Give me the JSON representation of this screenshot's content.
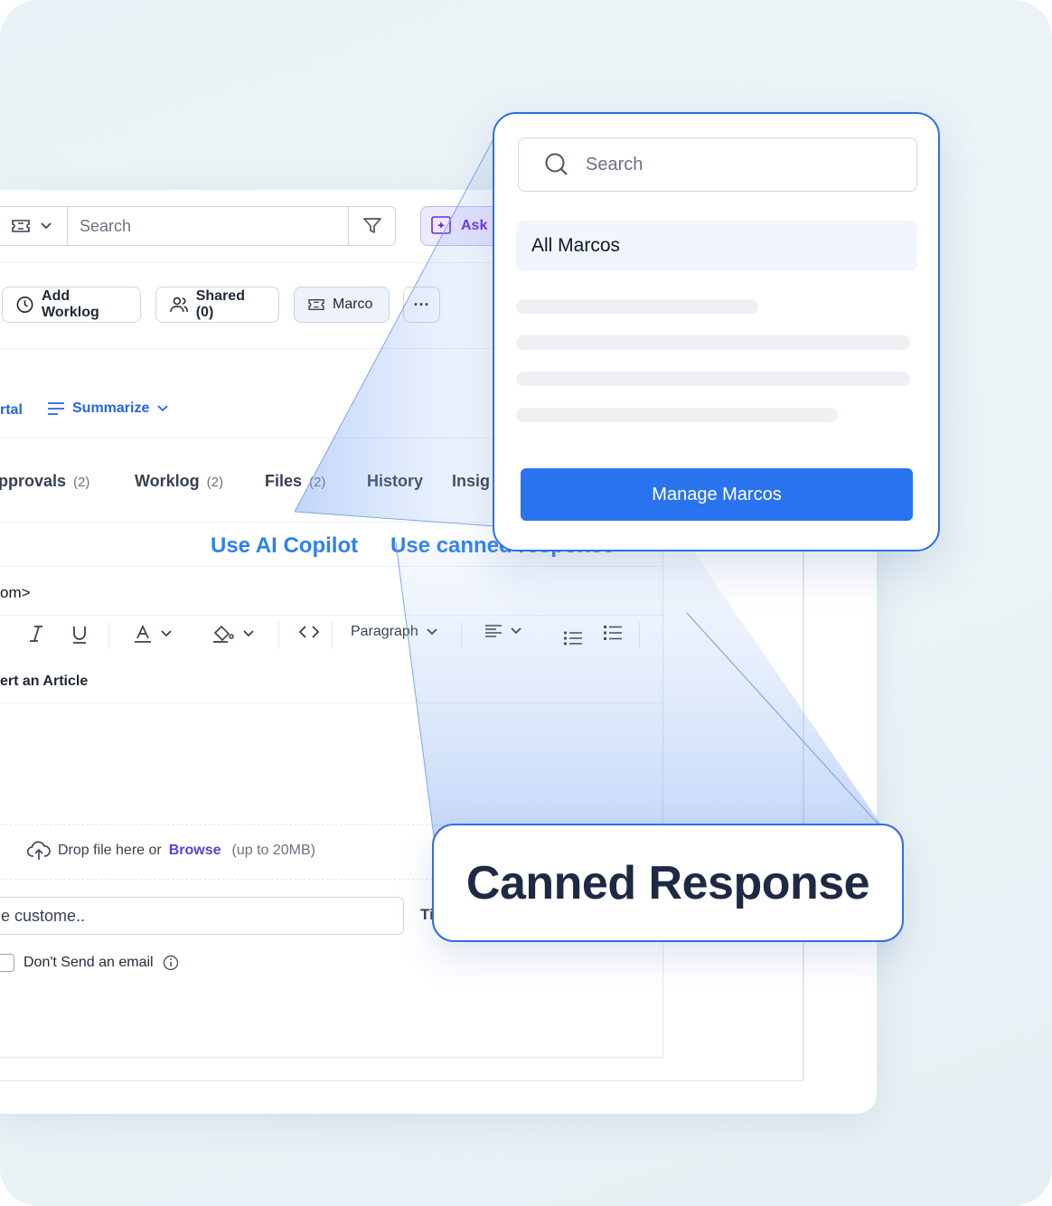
{
  "toolbar": {
    "search_placeholder": "Search",
    "ask_label": "Ask"
  },
  "actions": {
    "add_worklog": "Add Worklog",
    "shared": "Shared (0)",
    "marco": "Marco",
    "more": "···"
  },
  "summary_row": {
    "portal_fragment": "rtal",
    "summarize": "Summarize"
  },
  "tabs": [
    {
      "label": "pprovals",
      "count": "(2)"
    },
    {
      "label": "Worklog",
      "count": "(2)"
    },
    {
      "label": "Files",
      "count": "(2)"
    },
    {
      "label": "History",
      "count": ""
    },
    {
      "label": "Insig",
      "count": ""
    }
  ],
  "reply_modes": {
    "ai_copilot": "Use AI Copilot",
    "canned": "Use canned response"
  },
  "address_fragment": "om>",
  "format_toolbar": {
    "block_style": "Paragraph"
  },
  "insert_article_fragment": "ert an Article",
  "upload": {
    "drop_text": "Drop file here or",
    "browse": "Browse",
    "limit": "(up to 20MB)"
  },
  "customer_input_fragment": "e custome..",
  "ti_fragment": "Ti",
  "dont_send": "Don't Send an email",
  "popup": {
    "search_placeholder": "Search",
    "all_label": "All Marcos",
    "manage_button": "Manage Marcos"
  },
  "callout_title": "Canned Response",
  "colors": {
    "accent_blue": "#2a73ee",
    "link_blue": "#2f80ed",
    "frame_blue": "#2f6fe0",
    "ask_purple": "#6d28d9"
  }
}
